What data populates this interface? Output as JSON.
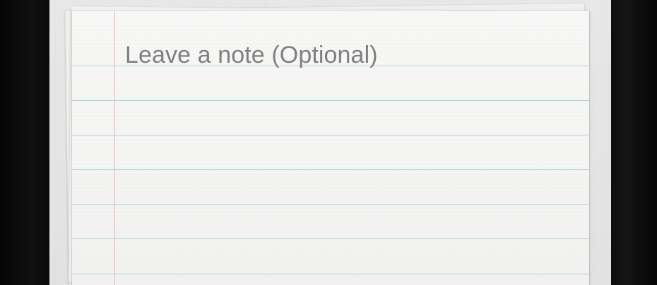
{
  "note": {
    "placeholder": "Leave a note (Optional)"
  },
  "colors": {
    "paper": "#f4f4f2",
    "rule_blue": "#a9cfe0",
    "margin_red": "#efb0b0",
    "placeholder_gray": "#7f7f7f"
  }
}
